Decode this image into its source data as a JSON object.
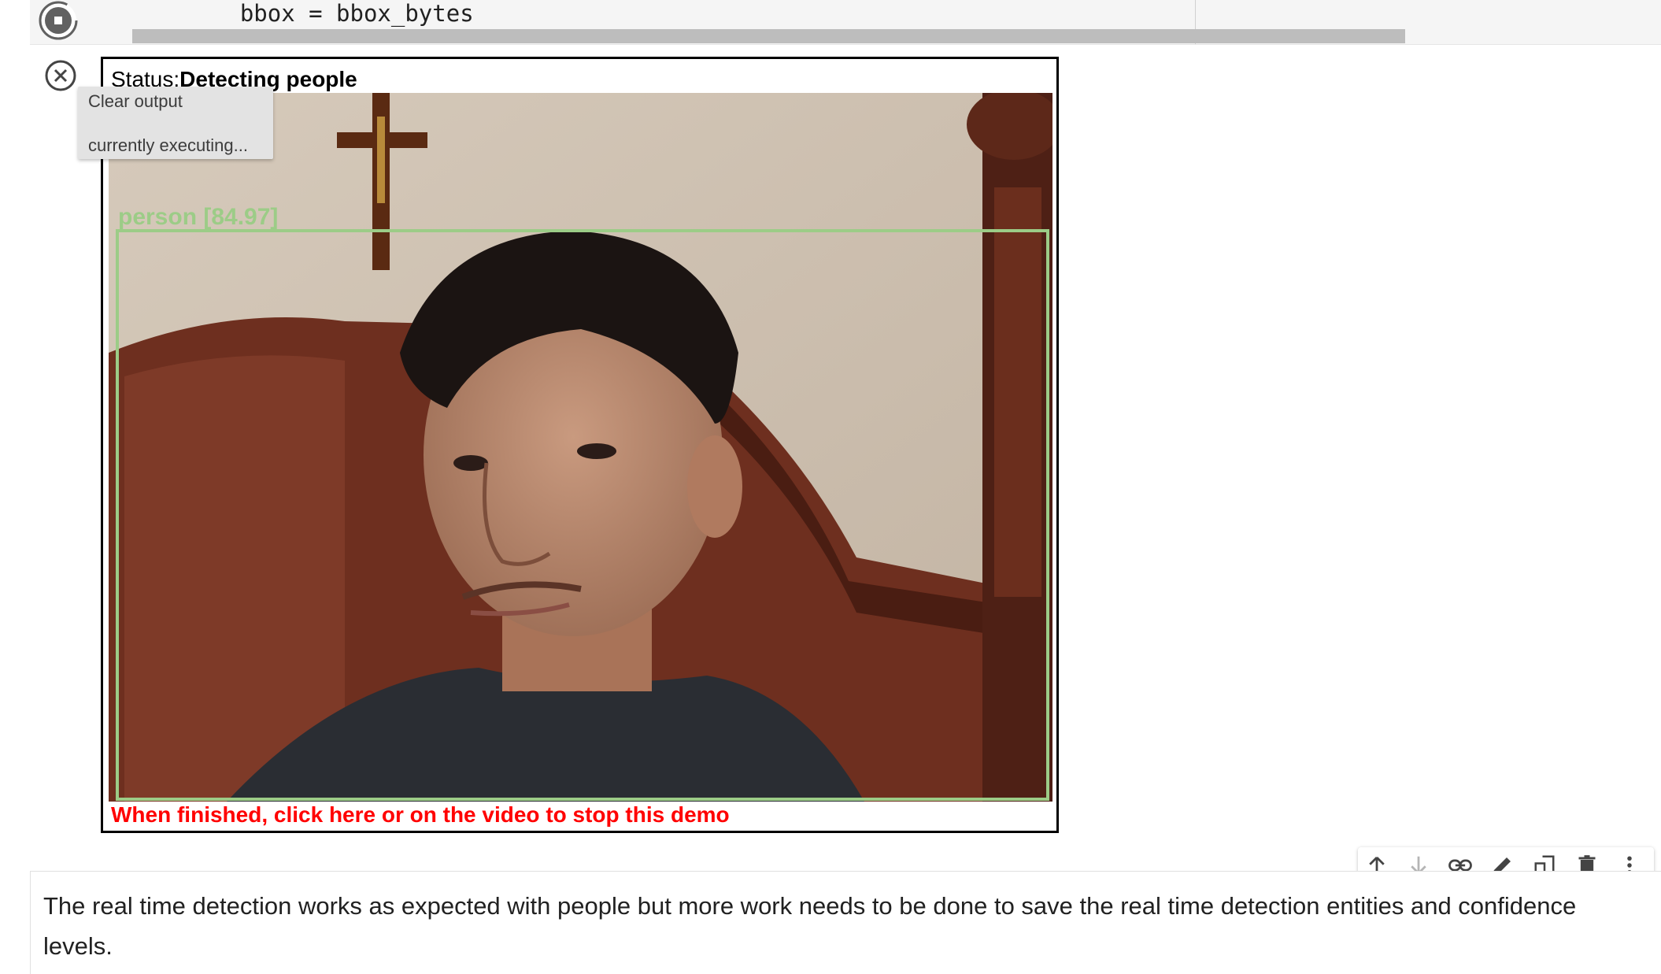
{
  "code_cell": {
    "code": "    bbox = bbox_bytes"
  },
  "output": {
    "tooltip": {
      "clear_output": "Clear output",
      "executing": "currently executing..."
    },
    "status_prefix": "Status:",
    "status_value": "Detecting people",
    "detection_label": "person [84.97]",
    "finish_message": "When finished, click here or on the video to stop this demo",
    "colors": {
      "bbox": "#9ccc87",
      "finish": "#ff0000"
    }
  },
  "toolbar": {
    "icons": [
      "arrow-up-icon",
      "arrow-down-icon",
      "link-icon",
      "edit-icon",
      "mirror-cell-icon",
      "delete-icon",
      "more-vert-icon"
    ]
  },
  "text_cell": {
    "text": "The real time detection works as expected with people but more work needs to be done to save the real time detection entities and confidence levels."
  }
}
